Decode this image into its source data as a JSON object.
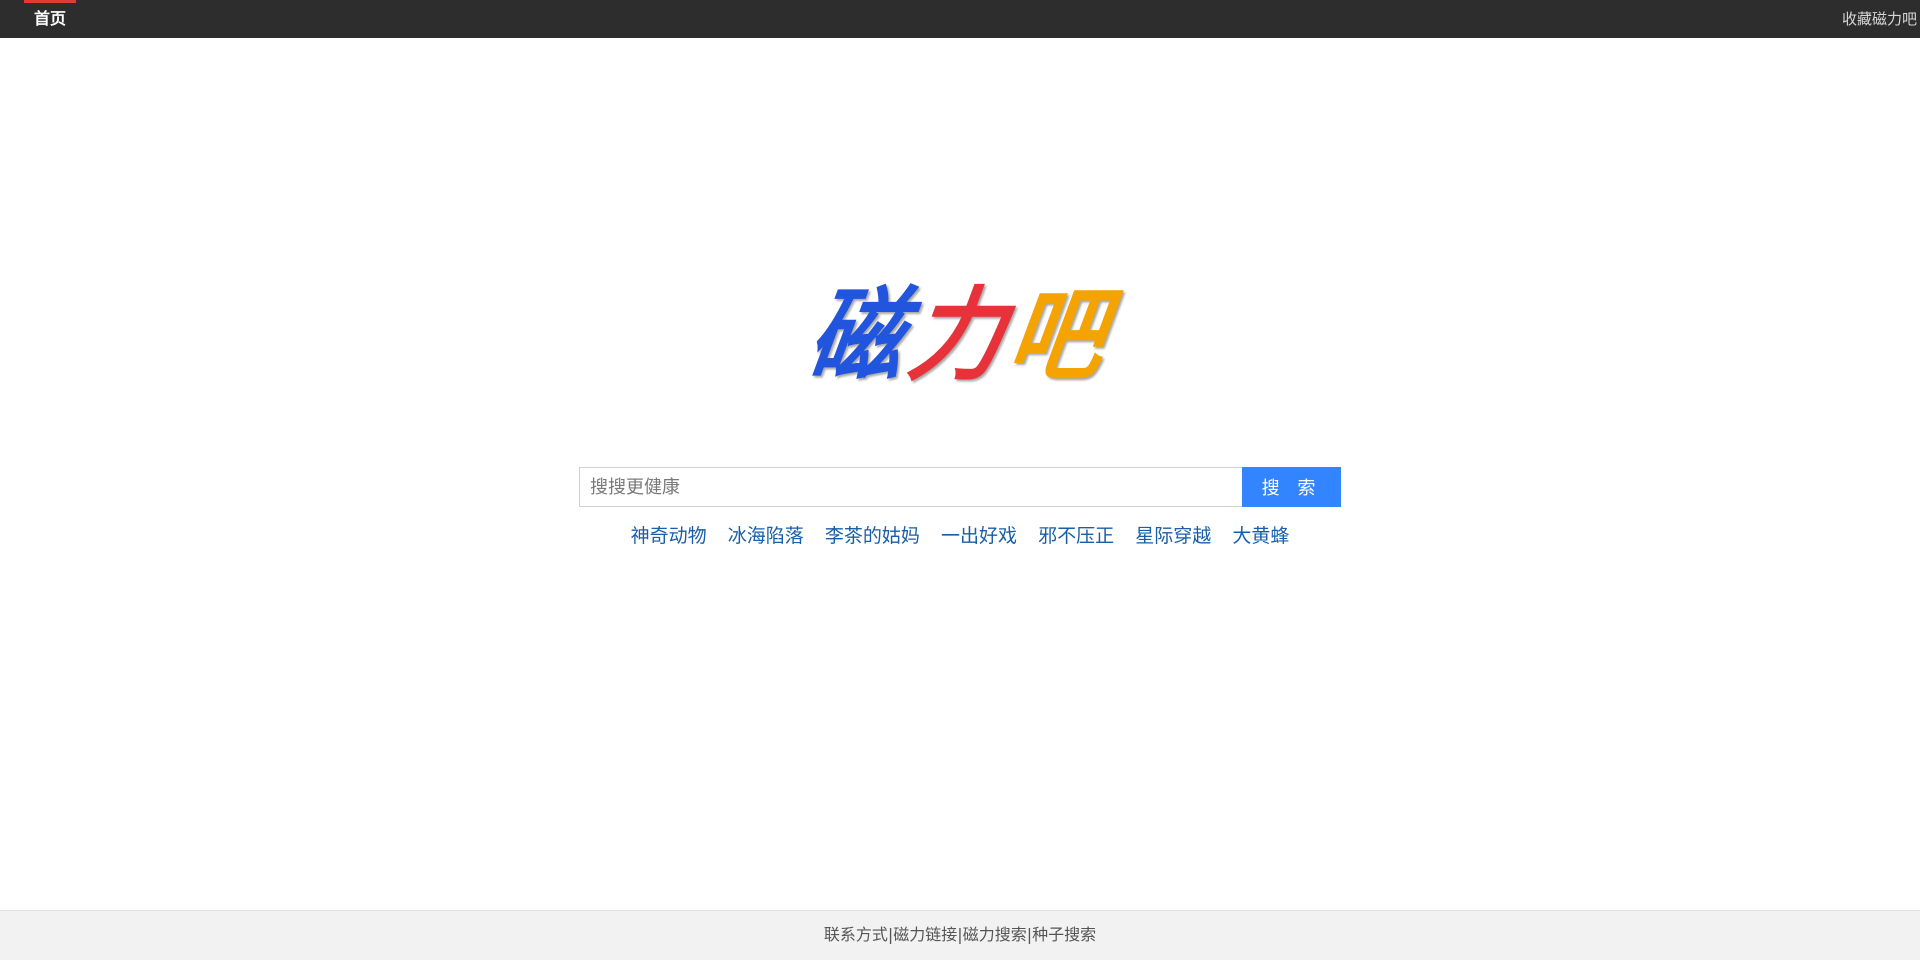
{
  "topbar": {
    "home_label": "首页",
    "bookmark_label": "收藏磁力吧",
    "active_color": "#e03c31",
    "background": "#2d2d2d"
  },
  "logo": {
    "chars": [
      {
        "text": "磁",
        "color": "#2255dd"
      },
      {
        "text": "力",
        "color": "#e8323a"
      },
      {
        "text": "吧",
        "color": "#f5a300"
      }
    ]
  },
  "search": {
    "placeholder": "搜搜更健康",
    "value": "",
    "button_label": "搜 索",
    "button_color": "#3385ff"
  },
  "hot_links": [
    "神奇动物",
    "冰海陷落",
    "李茶的姑妈",
    "一出好戏",
    "邪不压正",
    "星际穿越",
    "大黄蜂"
  ],
  "footer": {
    "links": [
      "联系方式",
      "磁力链接",
      "磁力搜索",
      "种子搜索"
    ],
    "separator": "|"
  }
}
